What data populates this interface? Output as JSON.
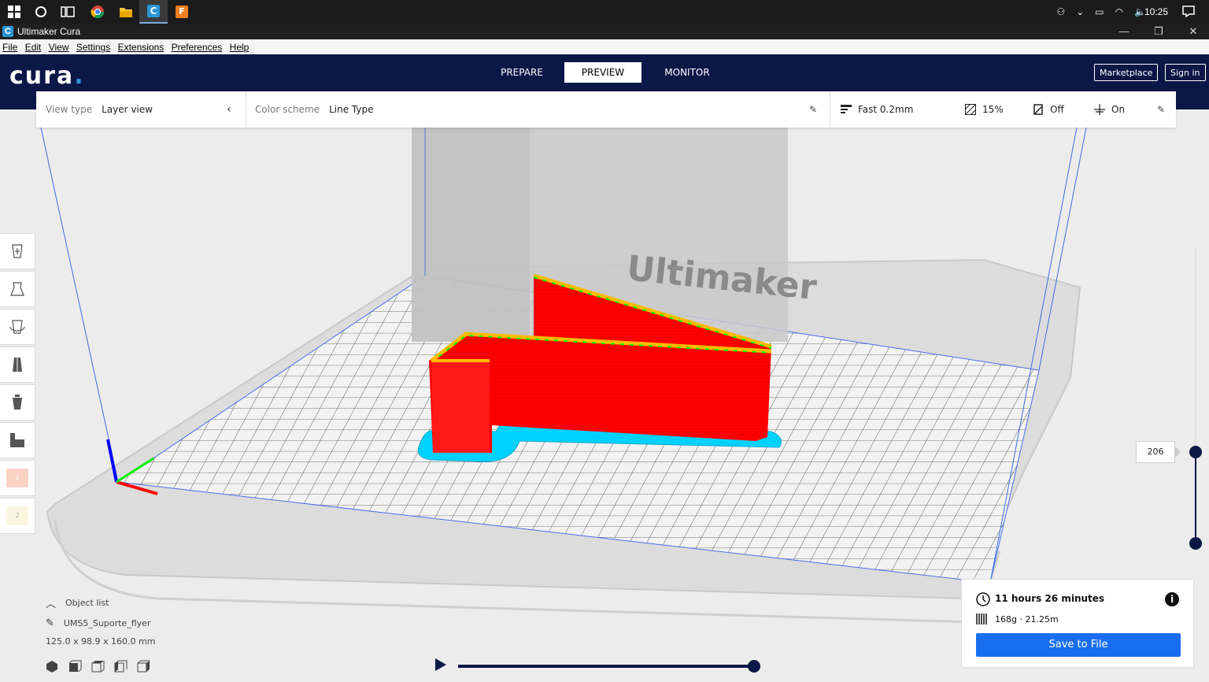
{
  "taskbar": {
    "icons": [
      "windows-start-icon",
      "search-circle-icon",
      "task-view-icon",
      "chrome-icon",
      "file-explorer-icon",
      "cura-app-icon",
      "fusion-icon"
    ],
    "fusion_letter": "F",
    "clock": "10:25"
  },
  "window": {
    "title": "Ultimaker Cura",
    "logo_letter": "C",
    "minimize": "—",
    "restore": "❐",
    "close": "✕"
  },
  "menu": [
    "File",
    "Edit",
    "View",
    "Settings",
    "Extensions",
    "Preferences",
    "Help"
  ],
  "header": {
    "logo": "cura",
    "logo_dot": ".",
    "tabs": [
      "PREPARE",
      "PREVIEW",
      "MONITOR"
    ],
    "active_tab": "PREVIEW",
    "marketplace": "Marketplace",
    "sign_in": "Sign in"
  },
  "toolbar": {
    "view_type_label": "View type",
    "view_type_value": "Layer view",
    "color_scheme_label": "Color scheme",
    "color_scheme_value": "Line Type",
    "profile": "Fast 0.2mm",
    "infill": "15%",
    "support": "Off",
    "adhesion": "On"
  },
  "scene": {
    "watermark": "Ultimaker"
  },
  "extruders": [
    "1",
    "2"
  ],
  "object_list": {
    "header": "Object list",
    "object_name": "UMS5_Suporte_flyer",
    "dimensions": "125.0 x 98.9 x 160.0 mm"
  },
  "layer_slider": {
    "current_layer": "206"
  },
  "summary": {
    "time": "11 hours 26 minutes",
    "material": "168g · 21.25m",
    "save": "Save to File",
    "info": "i"
  },
  "colors": {
    "header_bg": "#0b1746",
    "accent": "#196ef0",
    "wall": "#ff0000",
    "skin": "#ffbb00",
    "inner_wall": "#00ff00",
    "adhesion": "#00d2ff"
  }
}
